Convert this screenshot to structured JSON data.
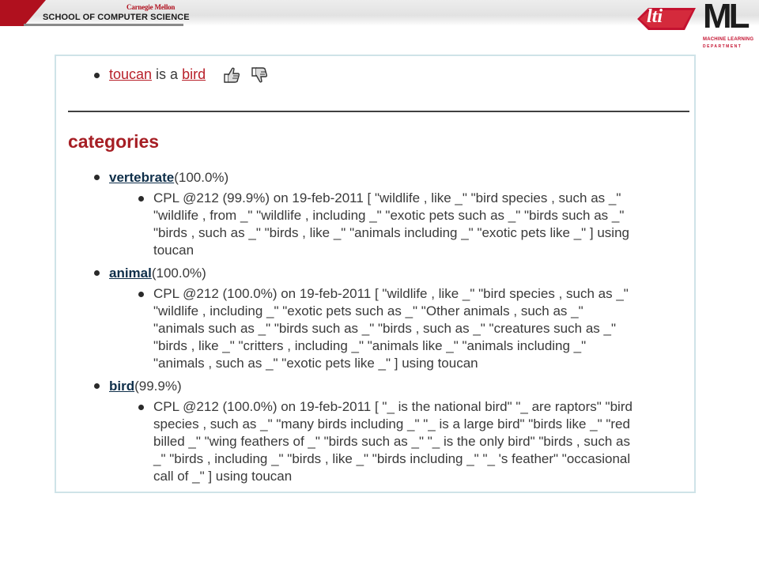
{
  "header": {
    "university": "Carnegie Mellon",
    "school": "SCHOOL OF COMPUTER SCIENCE",
    "lti_logo": "lti",
    "ml_logo": "ML",
    "ml_sub1": "MACHINE LEARNING",
    "ml_sub2": "DEPARTMENT"
  },
  "fact": {
    "subject": "toucan",
    "relation": " is a ",
    "object": "bird",
    "icons": [
      "thumbs-up-icon",
      "thumbs-down-icon"
    ]
  },
  "categories": {
    "heading": "categories",
    "items": [
      {
        "name": "vertebrate",
        "score": "(100.0%)",
        "evidence": "CPL @212 (99.9%) on 19-feb-2011 [ \"wildlife , like _\" \"bird species , such as _\" \"wildlife , from _\" \"wildlife , including _\" \"exotic pets such as _\" \"birds such as _\" \"birds , such as _\" \"birds , like _\" \"animals including _\" \"exotic pets like _\" ] using toucan"
      },
      {
        "name": "animal",
        "score": "(100.0%)",
        "evidence": "CPL @212 (100.0%) on 19-feb-2011 [ \"wildlife , like _\" \"bird species , such as _\" \"wildlife , including _\" \"exotic pets such as _\" \"Other animals , such as _\" \"animals such as _\" \"birds such as _\" \"birds , such as _\" \"creatures such as _\" \"birds , like _\" \"critters , including _\" \"animals like _\" \"animals including _\" \"animals , such as _\" \"exotic pets like _\" ] using toucan"
      },
      {
        "name": "bird",
        "score": "(99.9%)",
        "evidence": "CPL @212 (100.0%) on 19-feb-2011 [ \"_ is the national bird\" \"_ are raptors\" \"bird species , such as _\" \"many birds including _\" \"_ is a large bird\" \"birds like _\" \"red billed _\" \"wing feathers of _\" \"birds such as _\" \"_ is the only bird\" \"birds , such as _\" \"birds , including _\" \"birds , like _\" \"birds including _\" \"_ 's feather\" \"occasional call of _\" ] using toucan"
      }
    ]
  },
  "colors": {
    "link_red": "#b8202a",
    "heading_red": "#a61e24",
    "category_link": "#0f2f4a",
    "panel_border": "#cfe3e8"
  }
}
